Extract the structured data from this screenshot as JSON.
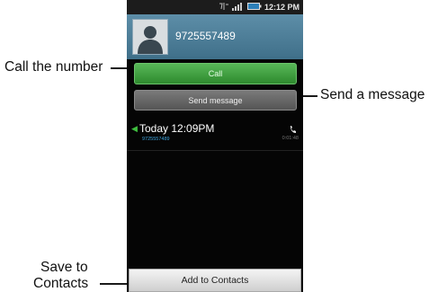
{
  "statusbar": {
    "time": "12:12 PM"
  },
  "contact": {
    "number": "9725557489"
  },
  "buttons": {
    "call": "Call",
    "send_message": "Send message",
    "add_to_contacts": "Add to Contacts"
  },
  "call_log": [
    {
      "time": "Today 12:09PM",
      "number": "9725557489",
      "duration": "0:01:48",
      "icon": "phone-icon"
    }
  ],
  "callouts": {
    "call_number": "Call the number",
    "send_message": "Send a message",
    "save_line1": "Save to",
    "save_line2": "Contacts"
  },
  "colors": {
    "header": "#4a7d98",
    "call_button": "#3e9e3e",
    "message_button": "#666666",
    "log_number": "#3fa6e0"
  }
}
